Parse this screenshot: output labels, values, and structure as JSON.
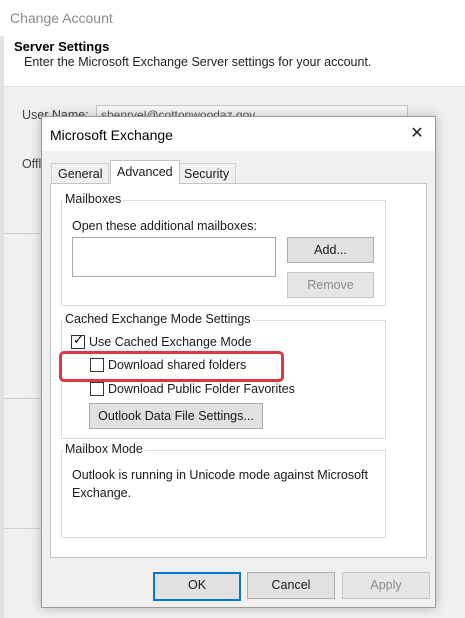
{
  "background_window": {
    "title": "Change Account",
    "section_title": "Server Settings",
    "section_desc": "Enter the Microsoft Exchange Server settings for your account.",
    "user_name_label": "User Name:",
    "user_name_value": "sbenryel@cottonwoodaz.gov",
    "offline_label": "Offl"
  },
  "dialog": {
    "title": "Microsoft Exchange",
    "close_glyph": "✕",
    "tabs": [
      {
        "label": "General",
        "active": false
      },
      {
        "label": "Advanced",
        "active": true
      },
      {
        "label": "Security",
        "active": false
      }
    ],
    "mailboxes": {
      "group_label": "Mailboxes",
      "open_label": "Open these additional mailboxes:",
      "add_label": "Add...",
      "remove_label": "Remove"
    },
    "cached": {
      "group_label": "Cached Exchange Mode Settings",
      "use_cached_label": "Use Cached Exchange Mode",
      "use_cached_checked": true,
      "download_shared_label": "Download shared folders",
      "download_shared_checked": false,
      "download_public_label": "Download Public Folder Favorites",
      "download_public_checked": false,
      "data_file_button": "Outlook Data File Settings...",
      "highlight_color": "#e03545"
    },
    "mailbox_mode": {
      "group_label": "Mailbox Mode",
      "text": "Outlook is running in Unicode mode against Microsoft Exchange."
    },
    "footer": {
      "ok_label": "OK",
      "cancel_label": "Cancel",
      "apply_label": "Apply"
    },
    "accent_color": "#0078d7"
  }
}
